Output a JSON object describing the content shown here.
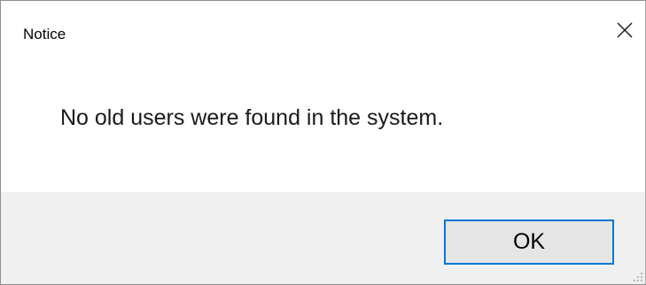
{
  "window": {
    "title": "Notice",
    "close_icon": "close-icon"
  },
  "content": {
    "message": "No old users were found in the system."
  },
  "footer": {
    "ok_label": "OK",
    "grip_icon": "resize-grip-icon"
  },
  "colors": {
    "accent": "#0078d7",
    "footer_bg": "#f0f0f0",
    "button_bg": "#e5e5e5"
  }
}
